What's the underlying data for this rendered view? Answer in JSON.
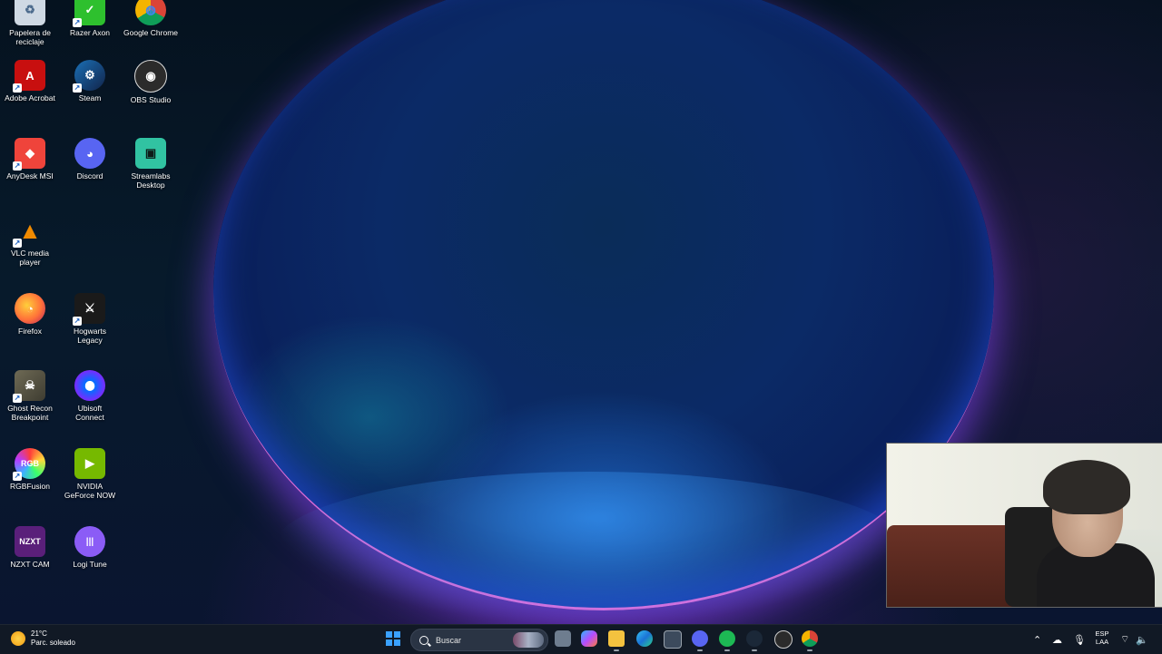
{
  "desktop": {
    "icons": [
      {
        "label": "Papelera de reciclaje",
        "icon": "recycle-bin-icon",
        "color": "#9fb6cf"
      },
      {
        "label": "Razer Axon",
        "icon": "razer-axon-icon",
        "color": "#2ec02e"
      },
      {
        "label": "Google Chrome",
        "icon": "chrome-icon",
        "color": "#e0b020"
      },
      {
        "label": "Adobe Acrobat",
        "icon": "adobe-acrobat-icon",
        "color": "#c80f0f"
      },
      {
        "label": "Steam",
        "icon": "steam-icon",
        "color": "#1b2838"
      },
      {
        "label": "OBS Studio",
        "icon": "obs-studio-icon",
        "color": "#2a2a2a"
      },
      {
        "label": "AnyDesk MSI",
        "icon": "anydesk-icon",
        "color": "#ef443b"
      },
      {
        "label": "Discord",
        "icon": "discord-icon",
        "color": "#5865f2"
      },
      {
        "label": "Streamlabs Desktop",
        "icon": "streamlabs-icon",
        "color": "#31c3a2"
      },
      {
        "label": "VLC media player",
        "icon": "vlc-icon",
        "color": "#f08a00"
      },
      {
        "label": "Firefox",
        "icon": "firefox-icon",
        "color": "#ff7139"
      },
      {
        "label": "Hogwarts Legacy",
        "icon": "hogwarts-legacy-icon",
        "color": "#1a1a1a"
      },
      {
        "label": "Ghost Recon Breakpoint",
        "icon": "ghost-recon-icon",
        "color": "#5d5a4a"
      },
      {
        "label": "Ubisoft Connect",
        "icon": "ubisoft-connect-icon",
        "color": "#0070ff"
      },
      {
        "label": "RGBFusion",
        "icon": "rgbfusion-icon",
        "color": "#222222"
      },
      {
        "label": "NVIDIA GeForce NOW",
        "icon": "nvidia-geforce-now-icon",
        "color": "#76b900"
      },
      {
        "label": "NZXT CAM",
        "icon": "nzxt-cam-icon",
        "color": "#5a1f7a"
      },
      {
        "label": "Logi Tune",
        "icon": "logi-tune-icon",
        "color": "#8b5cf6"
      }
    ],
    "glyphs": {
      "nzxt": "NZXT",
      "rgb": "RGB",
      "adobe": "A",
      "discord": "◕",
      "anydesk": "◆",
      "vlc": "▲",
      "steam": "⚙",
      "ubisoft": "◎",
      "nvidia": "▶",
      "logi": "|||",
      "obs": "◉",
      "chrome": "◍",
      "razer": "✓",
      "recycle": "♻",
      "streamlabs": "▣",
      "firefox": "◔",
      "hogwarts": "⚔",
      "ghost": "☠",
      "shortcut": "↗"
    }
  },
  "taskbar": {
    "weather_temp": "21°C",
    "weather_desc": "Parc. soleado",
    "search_placeholder": "Buscar",
    "lang_top": "ESP",
    "lang_bottom": "LAA"
  }
}
